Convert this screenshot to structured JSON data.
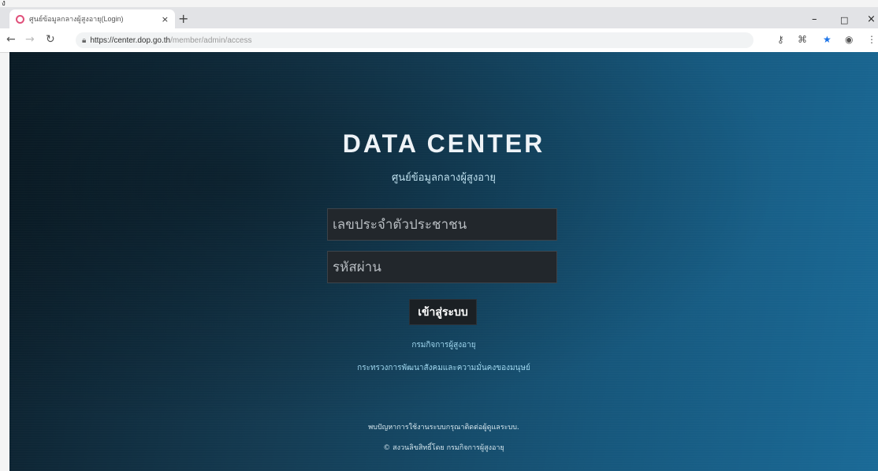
{
  "browser": {
    "tab_title": "ศูนย์ข้อมูลกลางผู้สูงอายุ(Login)",
    "tab_close": "×",
    "new_tab": "+",
    "url_main": "https://center.dop.go.th",
    "url_rest": "/member/admin/access",
    "icons": {
      "back": "back-arrow-icon",
      "forward": "forward-arrow-icon",
      "reload": "reload-icon",
      "lock": "lock-icon",
      "key": "key-icon",
      "translate": "translate-icon",
      "star": "star-icon",
      "account": "account-icon",
      "menu": "menu-icon"
    },
    "window": {
      "minimize": "–",
      "maximize": "□",
      "close": "×"
    }
  },
  "corner_mark": "ง",
  "login": {
    "title": "DATA CENTER",
    "subtitle": "ศูนย์ข้อมูลกลางผู้สูงอายุ",
    "id_placeholder": "เลขประจำตัวประชาชน",
    "password_placeholder": "รหัสผ่าน",
    "submit_label": "เข้าสู่ระบบ",
    "link_department": "กรมกิจการผู้สูงอายุ",
    "link_ministry": "กระทรวงการพัฒนาสังคมและความมั่นคงของมนุษย์"
  },
  "footer": {
    "help_text": "พบปัญหาการใช้งานระบบกรุณาติดต่อผู้ดูแลระบบ.",
    "copyright": "© สงวนลิขสิทธิ์โดย กรมกิจการผู้สูงอายุ"
  },
  "colors": {
    "bg_dark": "#0c1f2b",
    "bg_blue": "#1a6a97",
    "input_bg": "#22272c",
    "link": "#9fd6ee",
    "favicon": "#e0507a"
  }
}
